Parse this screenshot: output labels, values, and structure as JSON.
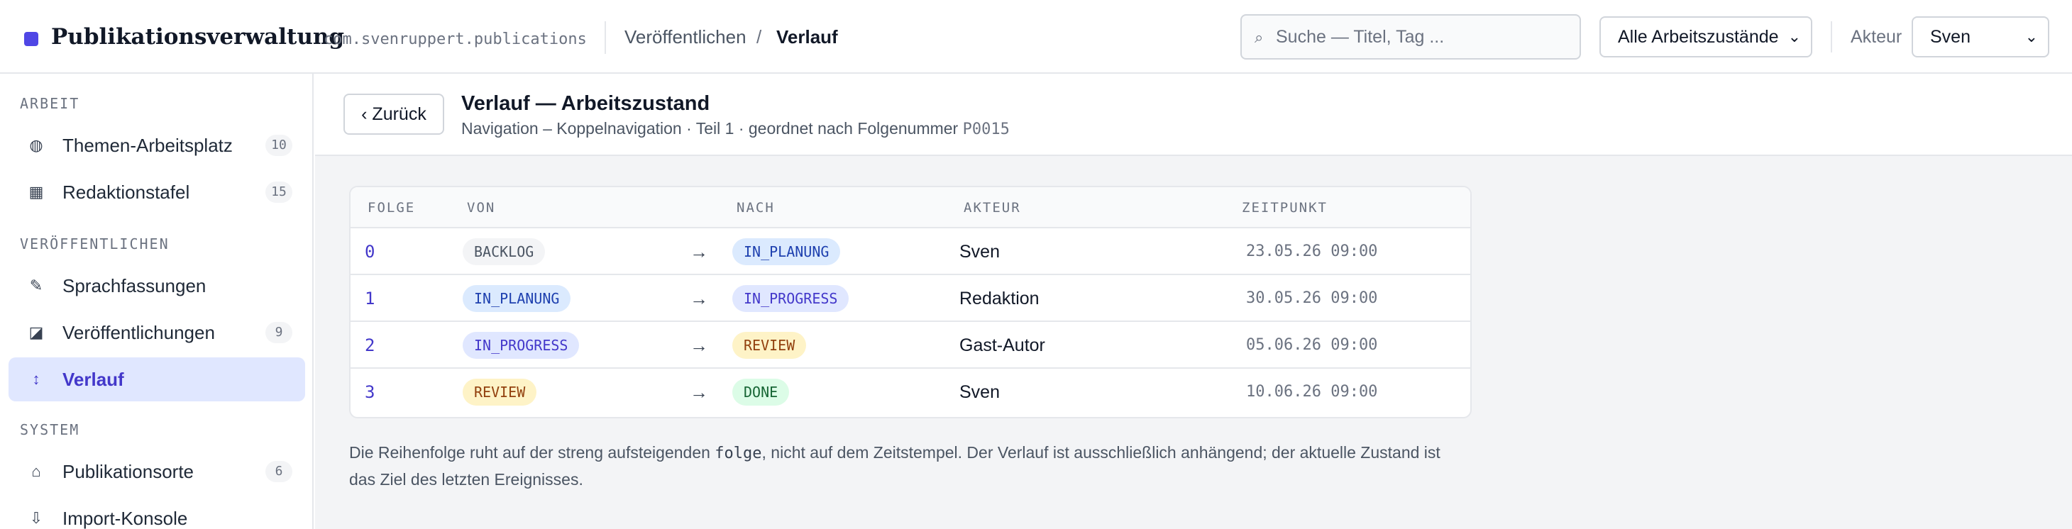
{
  "app": {
    "title": "Publikationsverwaltung",
    "package_id": "com.svenruppert.publications",
    "accent_color": "#4f46e5"
  },
  "breadcrumb": {
    "parent": "Veröffentlichen",
    "separator": "/",
    "current": "Verlauf"
  },
  "search": {
    "icon": "search-icon",
    "placeholder": "Suche — Titel, Tag ..."
  },
  "filters": {
    "state_selected": "Alle Arbeitszustände",
    "actor_label": "Akteur",
    "actor_selected": "Sven"
  },
  "sidebar": {
    "sections": [
      {
        "title": "ARBEIT",
        "items": [
          {
            "label": "Themen-Arbeitsplatz",
            "icon": "globe-icon",
            "count": "10"
          },
          {
            "label": "Redaktionstafel",
            "icon": "grid-icon",
            "count": "15"
          }
        ]
      },
      {
        "title": "VERÖFFENTLICHEN",
        "items": [
          {
            "label": "Sprachfassungen",
            "icon": "pencil-icon",
            "count": ""
          },
          {
            "label": "Veröffentlichungen",
            "icon": "contrast-icon",
            "count": "9"
          },
          {
            "label": "Verlauf",
            "icon": "updown-arrow-icon",
            "count": "",
            "active": true
          }
        ]
      },
      {
        "title": "SYSTEM",
        "items": [
          {
            "label": "Publikationsorte",
            "icon": "home-icon",
            "count": "6"
          },
          {
            "label": "Import-Konsole",
            "icon": "download-icon",
            "count": ""
          }
        ]
      }
    ]
  },
  "header": {
    "back_label": "‹ Zurück",
    "title": "Verlauf — Arbeitszustand",
    "subtitle": "Navigation – Koppelnavigation · Teil 1 · geordnet nach Folgenummer",
    "code": "P0015"
  },
  "table": {
    "columns": [
      "FOLGE",
      "VON",
      "NACH",
      "AKTEUR",
      "ZEITPUNKT"
    ],
    "arrow": "→",
    "rows": [
      {
        "folge": "0",
        "von": "BACKLOG",
        "nach": "IN_PLANUNG",
        "akteur": "Sven",
        "zeitpunkt": "23.05.26 09:00"
      },
      {
        "folge": "1",
        "von": "IN_PLANUNG",
        "nach": "IN_PROGRESS",
        "akteur": "Redaktion",
        "zeitpunkt": "30.05.26 09:00"
      },
      {
        "folge": "2",
        "von": "IN_PROGRESS",
        "nach": "REVIEW",
        "akteur": "Gast-Autor",
        "zeitpunkt": "05.06.26 09:00"
      },
      {
        "folge": "3",
        "von": "REVIEW",
        "nach": "DONE",
        "akteur": "Sven",
        "zeitpunkt": "10.06.26 09:00"
      }
    ]
  },
  "state_colors": {
    "BACKLOG": {
      "bg": "#f3f4f6",
      "fg": "#4b5563"
    },
    "IN_PLANUNG": {
      "bg": "#dbeafe",
      "fg": "#1e40af"
    },
    "IN_PROGRESS": {
      "bg": "#e0e7ff",
      "fg": "#4338ca"
    },
    "REVIEW": {
      "bg": "#fef3c7",
      "fg": "#92400e"
    },
    "DONE": {
      "bg": "#dcfce7",
      "fg": "#166534"
    }
  },
  "note": {
    "before": "Die Reihenfolge ruht auf der streng aufsteigenden ",
    "code": "folge",
    "after_line1": ", nicht auf dem Zeitstempel. Der Verlauf ist ausschließlich anhängend; der aktuelle Zustand ist",
    "line2": "das Ziel des letzten Ereignisses."
  }
}
